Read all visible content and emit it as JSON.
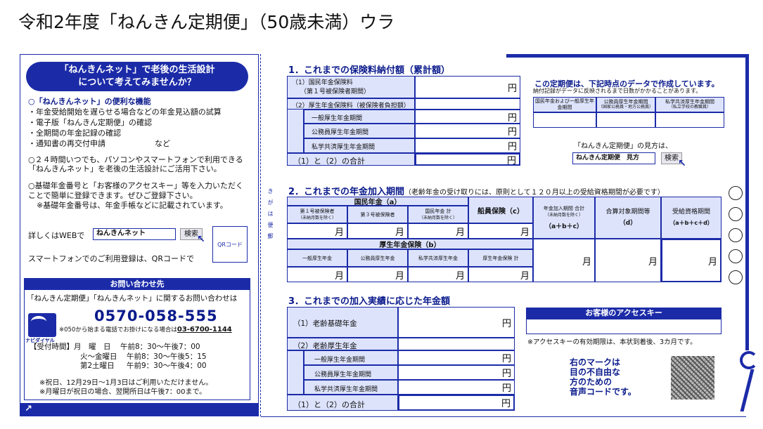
{
  "page_title": "令和2年度「ねんきん定期便」（50歳未満）ウラ",
  "left": {
    "heading_line1": "「ねんきんネット」で老後の生活設計",
    "heading_line2": "について考えてみませんか？",
    "features_title": "○「ねんきんネット」の便利な機能",
    "features": [
      "・年金受給開始を遅らせる場合などの年金見込額の試算",
      "・電子版「ねんきん定期便」の確認",
      "・全期間の年金記録の確認",
      "・通知書の再交付申請"
    ],
    "features_etc": "など",
    "anytime_line1": "○２４時間いつでも、パソコンやスマートフォンで利用できる",
    "anytime_line2": "「ねんきんネット」を老後の生活設計にご活用下さい。",
    "basic_line1": "○基礎年金番号と「お客様のアクセスキー」等を入力いただく",
    "basic_line2": "ことで簡単に登録できます。ぜひご登録下さい。",
    "basic_line3": "※基礎年金番号は、年金手帳などに記載されています。",
    "web_label": "詳しくはWEBで",
    "search_value": "ねんきんネット",
    "search_button": "検索",
    "qr_label": "QRコード",
    "smartphone_text": "スマートフォンでのご利用登録は、QRコードで",
    "contact_header": "お問い合わせ先",
    "contact_sub": "「ねんきん定期便」「ねんきんネット」に関するお問い合わせは",
    "phone": "0570-058-555",
    "navi_label": "ナビダイヤル",
    "alt_phone_note": "※050から始まる電話でお掛けになる場合は",
    "alt_phone": "03-6700-1144",
    "hours_label": "【受付時間】",
    "hours": [
      {
        "day": "月　曜　日",
        "time": "午前8：30～午後7：00"
      },
      {
        "day": "火～金曜日",
        "time": "午前8：30～午後5：15"
      },
      {
        "day": "第2土曜日",
        "time": "午前9：30～午後4：00"
      }
    ],
    "note1": "※祝日、12月29日～1月3日はご利用いただけません。",
    "note2": "※月曜日が祝日の場合、翌開所日は午後7：00まで。",
    "arrow": "↗"
  },
  "sec1": {
    "title": "1．これまでの保険料納付額（累計額）",
    "row1_a": "（1）国民年金保険料",
    "row1_b": "（第１号被保険者期間）",
    "row2": "（2）厚生年金保険料（被保険者負担額）",
    "sub1": "一般厚生年金期間",
    "sub2": "公務員厚生年金期間",
    "sub3": "私学共済厚生年金期間",
    "total": "（1）と（2）の合計",
    "yen": "円"
  },
  "info": {
    "title": "この定期便は、下記時点のデータで作成しています。",
    "note": "納付記録がデータに反映されるまで日数がかかることがあります。",
    "col1": "国民年金および一般厚生年金期間",
    "col2": "公務員厚生年金期間",
    "col2_sub": "（国家公務員・地方公務員）",
    "col3": "私学共済厚生年金期間",
    "col3_sub": "（私立学校の教職員）",
    "howto": "「ねんきん定期便」の見方は、",
    "howto_search": "ねんきん定期便　見方",
    "howto_button": "検索"
  },
  "sec2": {
    "title": "2．これまでの年金加入期間",
    "note": "（老齢年金の受け取りには、原則として１２０月以上の受給資格期間が必要です）",
    "kokumin": "国民年金（a）",
    "k1": "第１号被保険者",
    "k1_sub": "（未納月数を除く）",
    "k2": "第３号被保険者",
    "k3": "国民年金 計",
    "k3_sub": "（未納月数を除く）",
    "seninn": "船員保険（c）",
    "total_a": "年金加入期間 合計",
    "total_a_sub": "（未納月数を除く）",
    "total_a_formula": "（a＋b＋c）",
    "gassan": "合算対象期間等",
    "gassan_d": "（d）",
    "jukyu": "受給資格期間",
    "jukyu_formula": "（a＋b＋c＋d）",
    "kosei": "厚生年金保険（b）",
    "b1": "一般厚生年金",
    "b2": "公務員厚生年金",
    "b3": "私学共済厚生年金",
    "b4": "厚生年金保険 計",
    "month": "月"
  },
  "sec3": {
    "title": "3．これまでの加入実績に応じた年金額",
    "row1": "（1）老齢基礎年金",
    "row2": "（2）老齢厚生年金",
    "sub1": "一般厚生年金期間",
    "sub2": "公務員厚生年金期間",
    "sub3": "私学共済厚生年金期間",
    "total": "（1）と（2）の合計",
    "yen": "円"
  },
  "access": {
    "header": "お客様のアクセスキー",
    "note": "※アクセスキーの有効期限は、本状到着後、3カ月です。"
  },
  "voice": {
    "line1": "右のマークは",
    "line2": "目の不自由な",
    "line3": "方のための",
    "line4": "音声コードです。"
  },
  "side_label": "き　が　は　便　郵"
}
